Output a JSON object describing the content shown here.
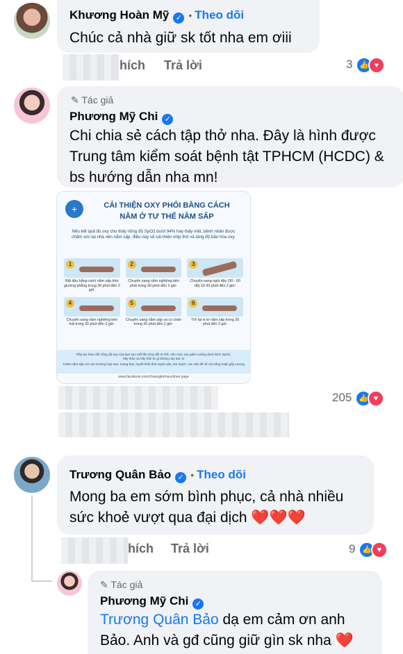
{
  "comments": [
    {
      "author": "Khương Hoàn Mỹ",
      "follow_label": "Theo dõi",
      "text": "Chúc cả nhà giữ sk tốt nha em ơiii",
      "like_label": "hích",
      "reply_label": "Trả lời",
      "reaction_count": "3"
    },
    {
      "author_tag": "Tác giả",
      "author": "Phương Mỹ Chi",
      "text": "Chi chia sẻ cách tập thở nha. Đây là hình được Trung tâm kiểm soát bệnh tật TPHCM (HCDC) & bs hướng dẫn nha mn!",
      "reaction_count": "205",
      "poster": {
        "title_line1": "CẢI THIỆN OXY PHỔI BẰNG CÁCH",
        "title_line2": "NẰM Ở TƯ THẾ NẰM SẤP",
        "intro": "Nếu kết quả đo oxy cho thấy nồng độ SpO2 dưới 94% hay thấy mệt, bệnh nhân được chăm sóc tại nhà nên nằm sấp, điều này sẽ cải thiện nhịp thở và tăng độ bão hòa oxy.",
        "steps": [
          {
            "num": "1",
            "caption": "Bắt đầu bằng cách nằm sấp trên giường phẳng trong 30 phút đến 2 giờ."
          },
          {
            "num": "2",
            "caption": "Chuyển sang nằm nghiêng bên phải trong 30 phút đến 2 giờ."
          },
          {
            "num": "3",
            "caption": "Chuyển sang ngồi dậy (30 - 60 độ) 10 30 phút đến 2 giờ."
          },
          {
            "num": "4",
            "caption": "Chuyển sang nằm nghiêng bên trái trong 30 phút đến 2 giờ."
          },
          {
            "num": "5",
            "caption": "Chuyển sang nằm sấp và co chân trong 30 phút đến 2 giờ."
          },
          {
            "num": "6",
            "caption": "Trở lại vị trí nằm sấp trong 30 phút đến 2 giờ."
          }
        ],
        "footer_line1": "Tiếp tục theo dõi nồng độ oxy của bạn sau mỗi lần thay đổi tư thế, nếu mức oxy giảm xuống dưới 92% SpO2,",
        "footer_line2": "hãy thảo và hãy hẵn từ gì không này bác sĩ",
        "footer_line3": "Tránh nằm sấp với các trường hợp sau: mang thai, huyết khối tĩnh mạch sâu, tim mạch, các vấn đề về cột sống hoặc gãy xương",
        "source": "www.facebook.com/chuongtrinhsuckhoe.page"
      }
    },
    {
      "author": "Trương Quân Bảo",
      "follow_label": "Theo dõi",
      "text": "Mong ba em sớm bình phục, cả nhà nhiều sức khoẻ vượt qua đại dịch ❤️❤️❤️",
      "like_label": "hích",
      "reply_label": "Trả lời",
      "reaction_count": "9"
    },
    {
      "author_tag": "Tác giả",
      "author": "Phương Mỹ Chi",
      "mention": "Trương Quân Bảo",
      "text": " dạ em cảm ơn anh Bảo. Anh và gđ cũng giữ gìn sk nha ❤️"
    }
  ],
  "icons": {
    "verified": "check-badge-icon",
    "like": "thumbs-up-icon",
    "love": "heart-icon",
    "pen": "pen-icon"
  },
  "colors": {
    "accent": "#1877f2",
    "bubble": "#f0f2f5",
    "muted": "#65676b",
    "love": "#f33e58"
  }
}
